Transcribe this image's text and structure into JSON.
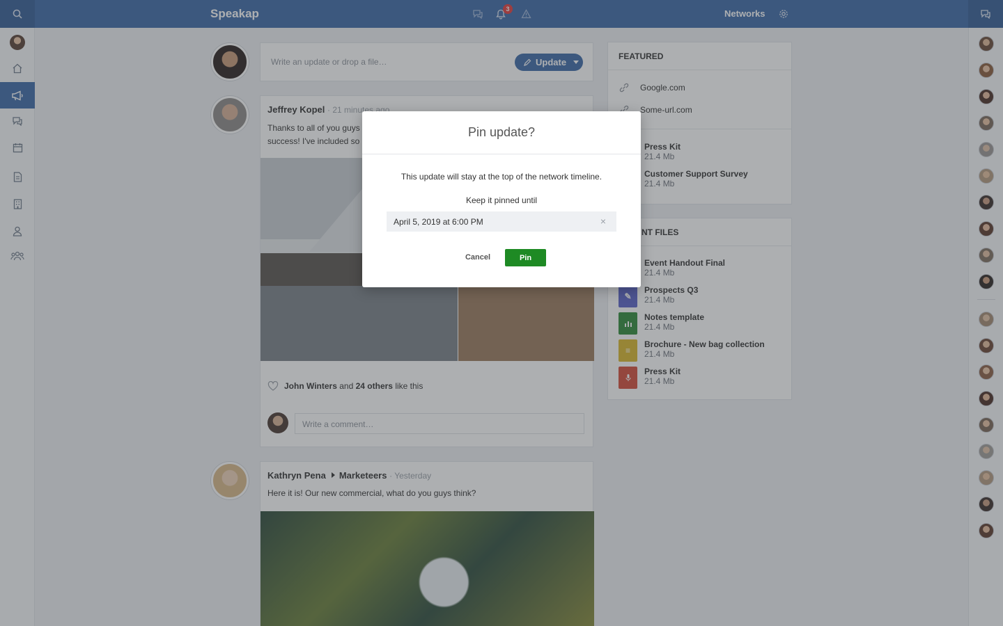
{
  "app": {
    "brand": "Speakap",
    "notification_count": "3",
    "networks_label": "Networks"
  },
  "nav": {
    "items": [
      "home-icon",
      "megaphone-icon",
      "chat-icon",
      "calendar-icon",
      "document-icon",
      "building-icon",
      "person-icon",
      "group-icon"
    ],
    "active": "megaphone-icon"
  },
  "composer": {
    "placeholder": "Write an update or drop a file…",
    "update_label": "Update"
  },
  "posts": [
    {
      "author": "Jeffrey Kopel",
      "time": "· 21 minutes ago",
      "text_line1": "Thanks to all of you guys",
      "text_line2": "success! I've included so",
      "likes_name": "John Winters",
      "likes_and": "and",
      "likes_others": "24 others",
      "likes_suffix": "like this",
      "comment_placeholder": "Write a comment…"
    },
    {
      "author": "Kathryn Pena",
      "group": "Marketeers",
      "time": "· Yesterday",
      "text": "Here it is! Our new commercial, what do you guys think?"
    }
  ],
  "featured": {
    "title": "FEATURED",
    "links": [
      "Google.com",
      "Some-url.com"
    ],
    "files": [
      {
        "name": "Press Kit",
        "size": "21.4 Mb"
      },
      {
        "name": "Customer Support Survey",
        "size": "21.4 Mb"
      }
    ]
  },
  "recent_files": {
    "title": "NT FILES",
    "files": [
      {
        "name": "Event Handout Final",
        "size": "21.4 Mb",
        "color": "#3d6aa8",
        "icon": "document-icon"
      },
      {
        "name": "Prospects Q3",
        "size": "21.4 Mb",
        "color": "#5b63c9",
        "icon": "pen-icon"
      },
      {
        "name": "Notes template",
        "size": "21.4 Mb",
        "color": "#2f8a3a",
        "icon": "spreadsheet-icon"
      },
      {
        "name": "Brochure - New bag collection",
        "size": "21.4 Mb",
        "color": "#d9b72c",
        "icon": "text-document-icon"
      },
      {
        "name": "Press Kit",
        "size": "21.4 Mb",
        "color": "#d44c3a",
        "icon": "microphone-icon"
      }
    ]
  },
  "dialog": {
    "title": "Pin update?",
    "message": "This update will stay at the top of the network timeline.",
    "pinned_until_label": "Keep it pinned until",
    "date_value": "April 5, 2019 at 6:00 PM",
    "clear_symbol": "×",
    "cancel_label": "Cancel",
    "pin_label": "Pin",
    "pin_color": "#1e8a24"
  }
}
